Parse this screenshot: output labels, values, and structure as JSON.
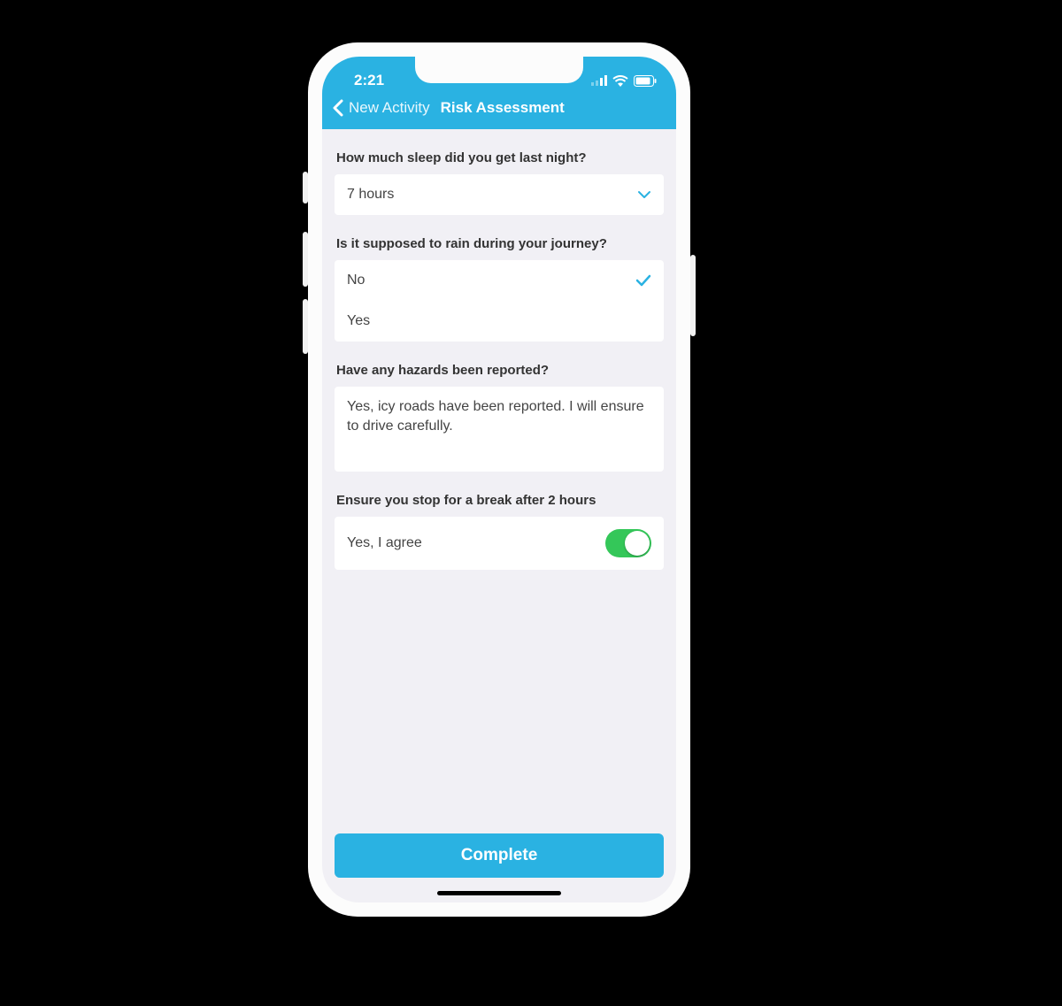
{
  "status": {
    "time": "2:21"
  },
  "nav": {
    "back_label": "New Activity",
    "title": "Risk Assessment"
  },
  "questions": {
    "sleep": {
      "label": "How much sleep did you get last night?",
      "value": "7 hours"
    },
    "rain": {
      "label": "Is it supposed to rain during your journey?",
      "options": [
        "No",
        "Yes"
      ],
      "selected_index": 0
    },
    "hazards": {
      "label": "Have any hazards been reported?",
      "value": "Yes, icy roads have been reported. I will ensure to drive carefully."
    },
    "break": {
      "label": "Ensure you stop for a break after 2 hours",
      "agree_text": "Yes, I agree",
      "toggled": true
    }
  },
  "footer": {
    "complete_label": "Complete"
  },
  "colors": {
    "accent": "#2ab2e2",
    "toggle_on": "#34c759"
  }
}
